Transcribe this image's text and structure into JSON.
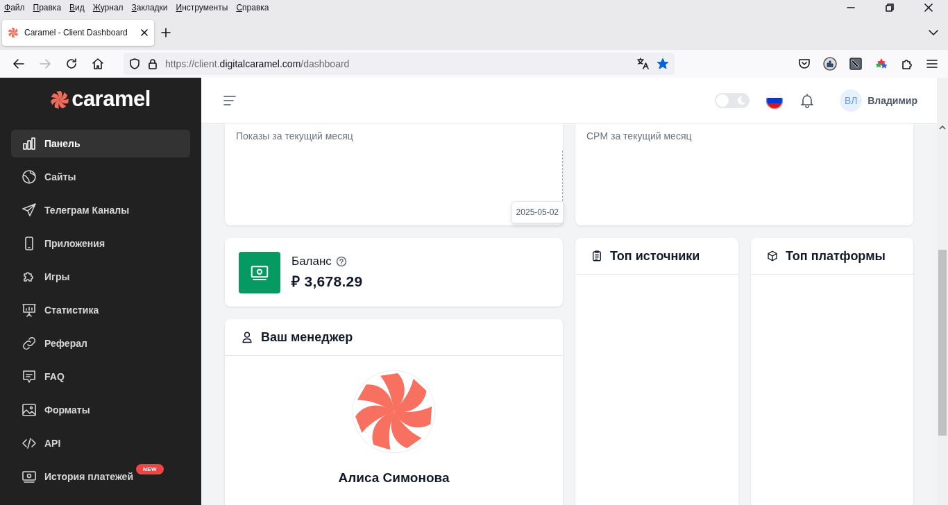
{
  "browser": {
    "menu": [
      "Файл",
      "Правка",
      "Вид",
      "Журнал",
      "Закладки",
      "Инструменты",
      "Справка"
    ],
    "tabs": [
      {
        "title": "Caramel - Client Dashboard",
        "selected": true
      }
    ],
    "url": {
      "scheme": "https://client.",
      "domain": "digitalcaramel.com",
      "path": "/dashboard"
    },
    "bookmarked": true
  },
  "sidebar": {
    "logo": "caramel",
    "items": [
      {
        "label": "Панель",
        "selected": true
      },
      {
        "label": "Сайты",
        "selected": false
      },
      {
        "label": "Телеграм Каналы",
        "selected": false
      },
      {
        "label": "Приложения",
        "selected": false
      },
      {
        "label": "Игры",
        "selected": false
      },
      {
        "label": "Статистика",
        "selected": false
      },
      {
        "label": "Реферал",
        "selected": false
      },
      {
        "label": "FAQ",
        "selected": false
      },
      {
        "label": "Форматы",
        "selected": false
      },
      {
        "label": "API",
        "selected": false
      },
      {
        "label": "История платежей",
        "selected": false,
        "badge": "NEW"
      }
    ]
  },
  "header": {
    "dark_mode": false,
    "user": {
      "initials": "ВЛ",
      "name": "Владимир"
    }
  },
  "stats": [
    {
      "caption": "Показы за текущий месяц",
      "tooltip": "2025-05-02"
    },
    {
      "caption": "CPM за текущий месяц"
    }
  ],
  "balance": {
    "title": "Баланс",
    "amount": "₽ 3,678.29"
  },
  "manager": {
    "title": "Ваш менеджер",
    "name": "Алиса Симонова"
  },
  "panels": [
    {
      "title": "Топ источники"
    },
    {
      "title": "Топ платформы"
    }
  ]
}
